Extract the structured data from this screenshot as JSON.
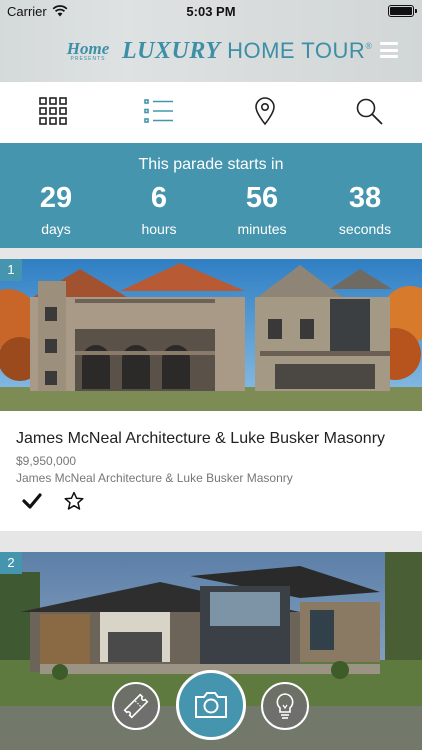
{
  "status_bar": {
    "carrier": "Carrier",
    "time": "5:03 PM"
  },
  "header": {
    "logo_small_top": "",
    "logo_home": "Home",
    "logo_small_bottom": "PRESENTS",
    "title_bold": "LUXURY",
    "title_rest": "HOME TOUR",
    "title_mark": "®",
    "menu_icon": "hamburger-menu-icon"
  },
  "toolbar": {
    "items": [
      {
        "name": "grid-view",
        "icon": "grid-icon"
      },
      {
        "name": "list-view",
        "icon": "list-icon",
        "active": true
      },
      {
        "name": "map-view",
        "icon": "map-pin-icon"
      },
      {
        "name": "search",
        "icon": "search-icon"
      }
    ],
    "active_color": "#4495ad"
  },
  "countdown": {
    "heading": "This parade starts in",
    "units": [
      {
        "value": "29",
        "label": "days"
      },
      {
        "value": "6",
        "label": "hours"
      },
      {
        "value": "56",
        "label": "minutes"
      },
      {
        "value": "38",
        "label": "seconds"
      }
    ],
    "background_color": "#4495ad"
  },
  "listings": [
    {
      "index": "1",
      "title": "James McNeal Architecture & Luke Busker Masonry",
      "price": "$9,950,000",
      "builder": "James McNeal Architecture & Luke Busker Masonry",
      "visited": true,
      "favorite": false
    },
    {
      "index": "2"
    }
  ],
  "bottom_actions": [
    {
      "name": "tickets",
      "icon": "ticket-icon"
    },
    {
      "name": "camera",
      "icon": "camera-icon"
    },
    {
      "name": "ideas",
      "icon": "lightbulb-icon"
    }
  ]
}
